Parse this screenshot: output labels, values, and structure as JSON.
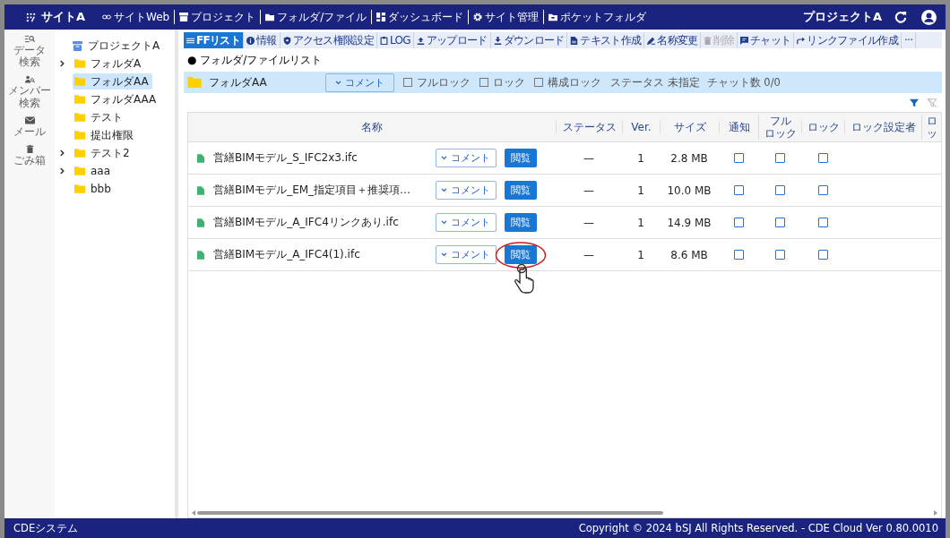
{
  "nav": {
    "site": "サイトA",
    "items": [
      {
        "label": "サイトWeb"
      },
      {
        "label": "プロジェクト"
      },
      {
        "label": "フォルダ/ファイル"
      },
      {
        "label": "ダッシュボード"
      },
      {
        "label": "サイト管理"
      },
      {
        "label": "ポケットフォルダ"
      }
    ],
    "project": "プロジェクトA"
  },
  "rail": [
    {
      "lines": [
        "データ",
        "検索"
      ]
    },
    {
      "lines": [
        "メンバー",
        "検索"
      ]
    },
    {
      "lines": [
        "メール"
      ]
    },
    {
      "lines": [
        "ごみ箱"
      ]
    }
  ],
  "tree": {
    "label": "プロジェクトA",
    "children": [
      {
        "label": "フォルダA",
        "expandable": true,
        "selected": false
      },
      {
        "label": "フォルダAA",
        "expandable": false,
        "selected": true
      },
      {
        "label": "フォルダAAA",
        "expandable": false,
        "selected": false
      },
      {
        "label": "テスト",
        "expandable": false,
        "selected": false
      },
      {
        "label": "提出権限",
        "expandable": false,
        "selected": false
      },
      {
        "label": "テスト2",
        "expandable": true,
        "selected": false
      },
      {
        "label": "aaa",
        "expandable": true,
        "selected": false
      },
      {
        "label": "bbb",
        "expandable": false,
        "selected": false
      }
    ]
  },
  "toolbar": [
    {
      "label": "FFリスト",
      "selected": true,
      "disabled": false
    },
    {
      "label": "情報",
      "selected": false,
      "disabled": false
    },
    {
      "label": "アクセス権限設定",
      "selected": false,
      "disabled": false
    },
    {
      "label": "LOG",
      "selected": false,
      "disabled": false
    },
    {
      "label": "アップロード",
      "selected": false,
      "disabled": false
    },
    {
      "label": "ダウンロード",
      "selected": false,
      "disabled": false
    },
    {
      "label": "テキスト作成",
      "selected": false,
      "disabled": false
    },
    {
      "label": "名称変更",
      "selected": false,
      "disabled": false
    },
    {
      "label": "削除",
      "selected": false,
      "disabled": true
    },
    {
      "label": "チャット",
      "selected": false,
      "disabled": false
    },
    {
      "label": "リンクファイル作成",
      "selected": false,
      "disabled": false
    },
    {
      "label": "···",
      "selected": false,
      "disabled": false
    }
  ],
  "section_title": "● フォルダ/ファイルリスト",
  "folder_bar": {
    "name": "フォルダAA",
    "comment": "コメント",
    "locks": [
      {
        "label": "フルロック",
        "checked": false
      },
      {
        "label": "ロック",
        "checked": false
      },
      {
        "label": "構成ロック",
        "checked": false
      }
    ],
    "status": "ステータス 未指定",
    "chat": "チャット数 0/0"
  },
  "table": {
    "columns": [
      {
        "lines": [
          "名称"
        ]
      },
      {
        "lines": [
          "ステータス"
        ]
      },
      {
        "lines": [
          "Ver."
        ]
      },
      {
        "lines": [
          "サイズ"
        ]
      },
      {
        "lines": [
          "通知"
        ]
      },
      {
        "lines": [
          "フル",
          "ロック"
        ]
      },
      {
        "lines": [
          "ロック"
        ]
      },
      {
        "lines": [
          "ロック設定者"
        ]
      },
      {
        "lines": [
          "ロッ"
        ]
      }
    ],
    "rows": [
      {
        "name": "営繕BIMモデル_S_IFC2x3.ifc",
        "comment": "コメント",
        "view": "閲覧",
        "status": "—",
        "ver": "1",
        "size": "2.8 MB",
        "notify": false,
        "full_lock": false,
        "lock": false,
        "highlighted": false
      },
      {
        "name": "営繕BIMモデル_EM_指定項目＋推奨項…",
        "comment": "コメント",
        "view": "閲覧",
        "status": "—",
        "ver": "1",
        "size": "10.0 MB",
        "notify": false,
        "full_lock": false,
        "lock": false,
        "highlighted": false
      },
      {
        "name": "営繕BIMモデル_A_IFC4リンクあり.ifc",
        "comment": "コメント",
        "view": "閲覧",
        "status": "—",
        "ver": "1",
        "size": "14.9 MB",
        "notify": false,
        "full_lock": false,
        "lock": false,
        "highlighted": false
      },
      {
        "name": "営繕BIMモデル_A_IFC4(1).ifc",
        "comment": "コメント",
        "view": "閲覧",
        "status": "—",
        "ver": "1",
        "size": "8.6 MB",
        "notify": false,
        "full_lock": false,
        "lock": false,
        "highlighted": true
      }
    ]
  },
  "footer": {
    "left": "CDEシステム",
    "right": "Copyright © 2024 bSJ All Rights Reserved. - CDE Cloud Ver 0.80.0010"
  }
}
